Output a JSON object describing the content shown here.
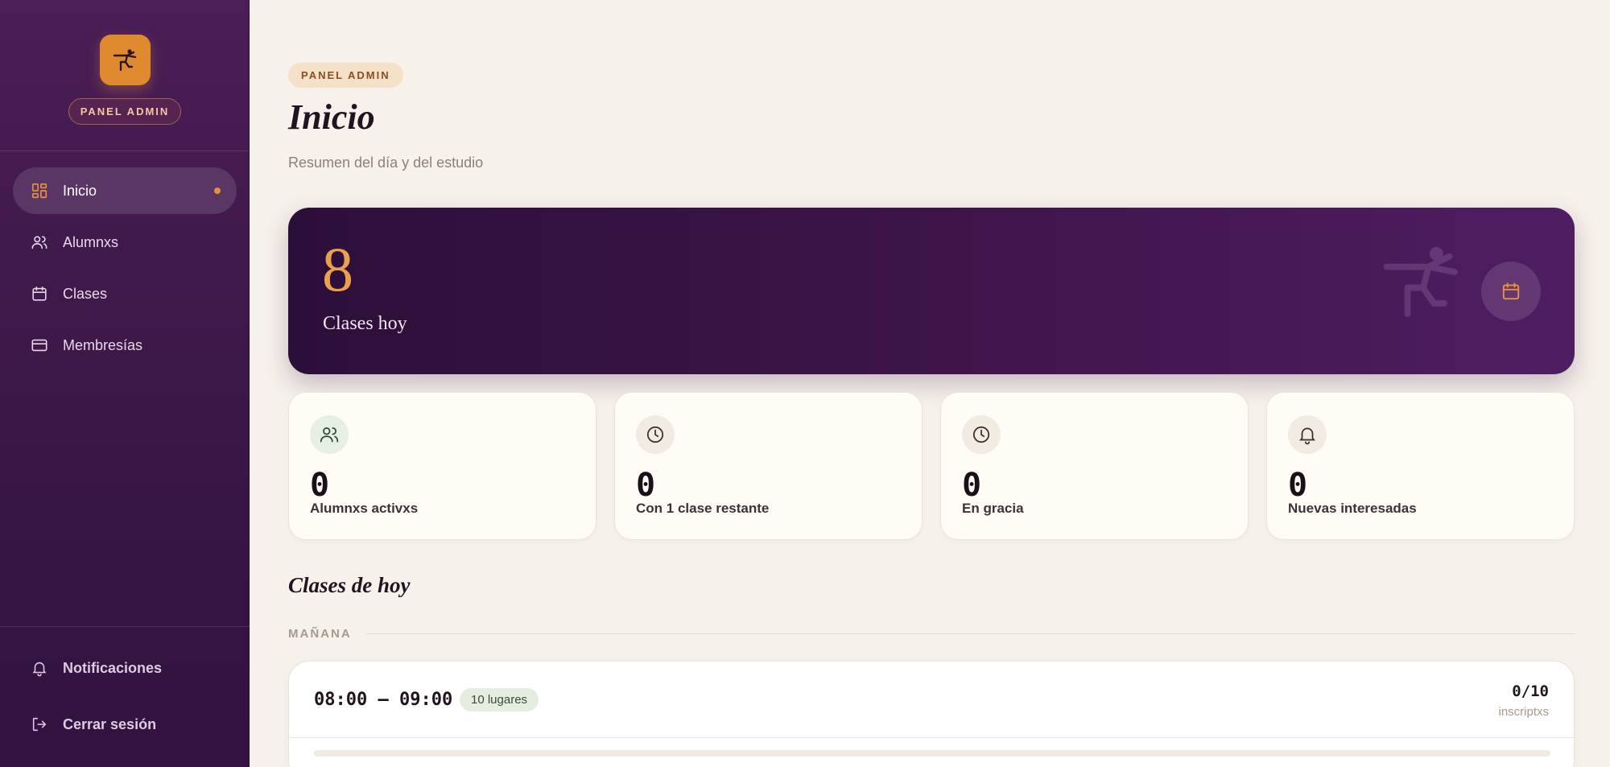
{
  "sidebar": {
    "brand_pill": "PANEL ADMIN",
    "items": [
      {
        "label": "Inicio",
        "icon": "dashboard-icon",
        "active": true
      },
      {
        "label": "Alumnxs",
        "icon": "users-icon"
      },
      {
        "label": "Clases",
        "icon": "calendar-icon"
      },
      {
        "label": "Membresías",
        "icon": "credit-card-icon"
      }
    ],
    "bottom": [
      {
        "label": "Notificaciones",
        "icon": "bell-icon"
      },
      {
        "label": "Cerrar sesión",
        "icon": "logout-icon"
      }
    ]
  },
  "header": {
    "eyebrow": "PANEL ADMIN",
    "title": "Inicio",
    "subtitle": "Resumen del día y del estudio"
  },
  "hero": {
    "value": "8",
    "label": "Clases hoy",
    "icon": "calendar-icon"
  },
  "stats": [
    {
      "value": "0",
      "label": "Alumnxs activxs",
      "icon": "users-icon",
      "icon_bg": "#e6efe4"
    },
    {
      "value": "0",
      "label": "Con 1 clase restante",
      "icon": "clock-icon",
      "icon_bg": "#f1ebe2"
    },
    {
      "value": "0",
      "label": "En gracia",
      "icon": "clock-icon",
      "icon_bg": "#f1ebe2"
    },
    {
      "value": "0",
      "label": "Nuevas interesadas",
      "icon": "bell-icon",
      "icon_bg": "#f1ebe2"
    }
  ],
  "today": {
    "title": "Clases de hoy",
    "period": "MAÑANA",
    "classes": [
      {
        "time": "08:00 — 09:00",
        "capacity": "10 lugares",
        "count": "0/10",
        "count_label": "inscriptxs",
        "fill": 0
      }
    ]
  },
  "colors": {
    "accent": "#e08a30",
    "sidebar": "#3a1746",
    "hero": "#3d1549",
    "background": "#f6f1ea"
  }
}
